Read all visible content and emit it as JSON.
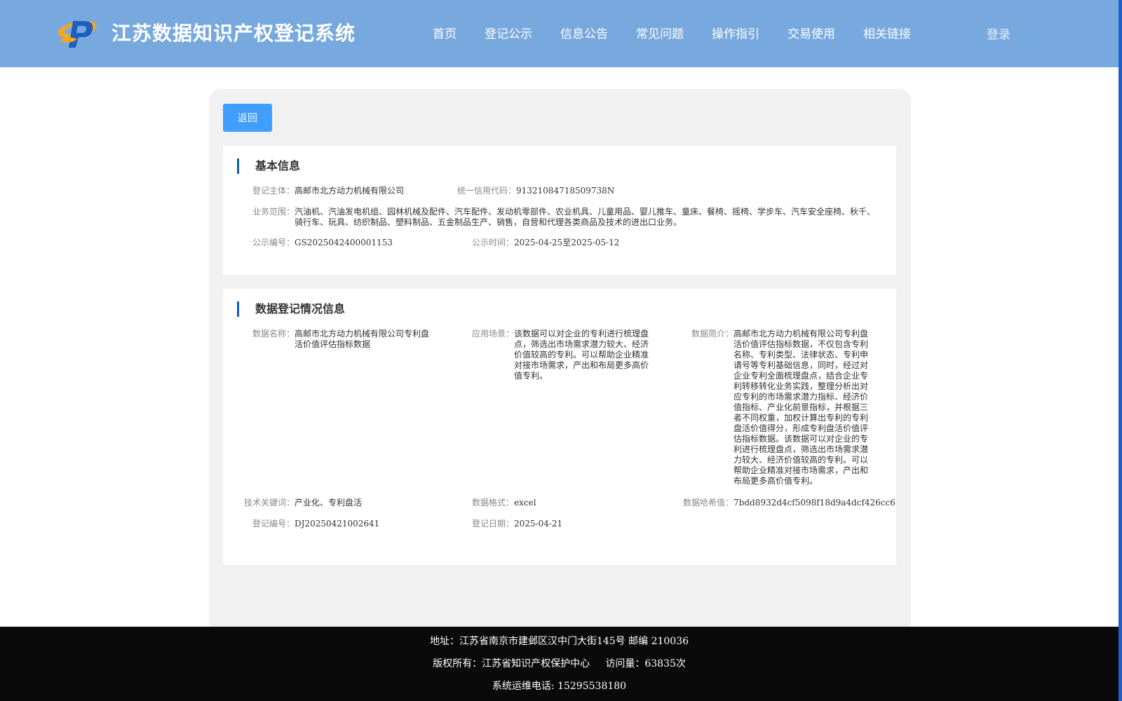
{
  "header": {
    "title": "江苏数据知识产权登记系统",
    "nav": [
      "首页",
      "登记公示",
      "信息公告",
      "常见问题",
      "操作指引",
      "交易使用",
      "相关链接"
    ],
    "login": "登录"
  },
  "back_button": "返回",
  "basic": {
    "title": "基本信息",
    "subject_label": "登记主体：",
    "subject": "高邮市北方动力机械有限公司",
    "credit_label": "统一信用代码：",
    "credit": "91321084718509738N",
    "scope_label": "业务范围：",
    "scope": "汽油机、汽油发电机组、园林机械及配件、汽车配件、发动机零部件、农业机具、儿童用品、婴儿推车、童床、餐椅、摇椅、学步车、汽车安全座椅、秋千、骑行车、玩具、纺织制品、塑料制品、五金制品生产、销售，自营和代理各类商品及技术的进出口业务。",
    "notice_no_label": "公示编号：",
    "notice_no": "GS2025042400001153",
    "notice_time_label": "公示时间：",
    "notice_time": "2025-04-25至2025-05-12"
  },
  "registration": {
    "title": "数据登记情况信息",
    "name_label": "数据名称：",
    "name": "高邮市北方动力机械有限公司专利盘活价值评估指标数据",
    "scene_label": "应用场景：",
    "scene": "该数据可以对企业的专利进行梳理盘点，筛选出市场需求潜力较大、经济价值较高的专利。可以帮助企业精准对接市场需求，产出和布局更多高价值专利。",
    "intro_label": "数据简介：",
    "intro": "高邮市北方动力机械有限公司专利盘活价值评估指标数据，不仅包含专利名称、专利类型、法律状态、专利申请号等专利基础信息，同时，经过对企业专利全面梳理盘点，结合企业专利转移转化业务实践，整理分析出对应专利的市场需求潜力指标、经济价值指标、产业化前景指标，并根据三者不同权重，加权计算出专利的专利盘活价值得分，形成专利盘活价值评估指标数据。该数据可以对企业的专利进行梳理盘点，筛选出市场需求潜力较大、经济价值较高的专利。可以帮助企业精准对接市场需求，产出和布局更多高价值专利。",
    "keywords_label": "技术关键词：",
    "keywords": "产业化、专利盘活",
    "format_label": "数据格式：",
    "format": "excel",
    "hash_label": "数据哈希值：",
    "hash": "7bdd8932d4cf5098f18d9a4dcf426cc6",
    "reg_no_label": "登记编号：",
    "reg_no": "DJ20250421002641",
    "reg_date_label": "登记日期：",
    "reg_date": "2025-04-21"
  },
  "footer": {
    "address": "地址：江苏省南京市建邺区汉中门大街145号 邮编 210036",
    "copyright": "版权所有：江苏省知识产权保护中心",
    "visits": "访问量：63835次",
    "phone": "系统运维电话: 15295538180"
  },
  "colors": {
    "header_bg": "#78a9de",
    "accent_blue": "#409eff",
    "title_bar": "#0e5fb3",
    "footer_bg": "#0a0a0a"
  }
}
